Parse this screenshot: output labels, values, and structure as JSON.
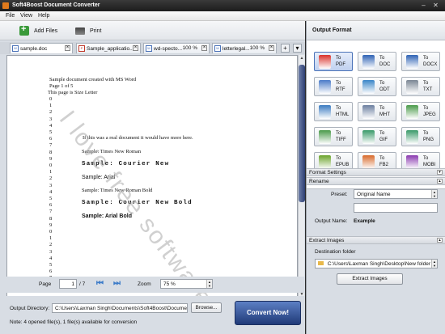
{
  "window": {
    "title": "Soft4Boost Document Converter"
  },
  "menu": [
    "File",
    "View",
    "Help"
  ],
  "toolbar": {
    "add_files": "Add Files",
    "print": "Print"
  },
  "tabs": [
    {
      "name": "sample.doc",
      "zoom": ""
    },
    {
      "name": "Sample_applicatio...",
      "zoom": ""
    },
    {
      "name": "wd-specto...",
      "zoom": "100 %"
    },
    {
      "name": "letterlegal...",
      "zoom": "100 %"
    }
  ],
  "document": {
    "header": [
      "Sample document created with MS Word",
      "Page 1 of 5",
      "This page is Size Letter"
    ],
    "numbers": [
      "0",
      "1",
      "2",
      "3",
      "4",
      "5",
      "6",
      "7",
      "8",
      "9",
      "0",
      "1",
      "2",
      "3",
      "4",
      "5",
      "6",
      "7",
      "8",
      "9",
      "0",
      "1",
      "2",
      "3",
      "4",
      "5",
      "6",
      "7"
    ],
    "samples": [
      "If this was a real document it would have more here.",
      "Sample:  Times New Roman",
      "Sample:  Courier New",
      "Sample:  Arial",
      "Sample:  Times New Roman Bold",
      "Sample:  Courier New Bold",
      "Sample:  Arial Bold"
    ],
    "watermark": "I love free software"
  },
  "pager": {
    "page_label": "Page",
    "page_value": "1",
    "page_total": "/ 7",
    "zoom_label": "Zoom",
    "zoom_value": "75 %"
  },
  "output": {
    "dir_label": "Output Directory:",
    "dir_value": "C:\\Users\\Laxman Singh\\Documents\\Soft4Boost\\Document",
    "browse": "Browse...",
    "note": "Note: 4 opened file(s), 1 file(s) available for conversion",
    "convert": "Convert Now!"
  },
  "right": {
    "header": "Output Format",
    "formats": [
      {
        "to": "To",
        "name": "PDF",
        "color": "#d9312b"
      },
      {
        "to": "To",
        "name": "DOC",
        "color": "#2f63b5"
      },
      {
        "to": "To",
        "name": "DOCX",
        "color": "#2f63b5"
      },
      {
        "to": "To",
        "name": "RTF",
        "color": "#4b7bc8"
      },
      {
        "to": "To",
        "name": "ODT",
        "color": "#3a86c8"
      },
      {
        "to": "To",
        "name": "TXT",
        "color": "#7a8694"
      },
      {
        "to": "To",
        "name": "HTML",
        "color": "#3a7ac0"
      },
      {
        "to": "To",
        "name": "MHT",
        "color": "#6b7fa0"
      },
      {
        "to": "To",
        "name": "JPEG",
        "color": "#4a9a4a"
      },
      {
        "to": "To",
        "name": "TIFF",
        "color": "#4a9a4a"
      },
      {
        "to": "To",
        "name": "GIF",
        "color": "#3a9a6a"
      },
      {
        "to": "To",
        "name": "PNG",
        "color": "#3a9a6a"
      },
      {
        "to": "To",
        "name": "EPUB",
        "color": "#6aa32b"
      },
      {
        "to": "To",
        "name": "FB2",
        "color": "#d86a2b"
      },
      {
        "to": "To",
        "name": "MOBI",
        "color": "#8a3ab0"
      }
    ],
    "format_settings": "Format Settings",
    "rename": "Rename",
    "preset_label": "Preset:",
    "preset_value": "Original Name",
    "output_name_label": "Output Name:",
    "output_name_value": "Example",
    "extract_images": "Extract Images",
    "dest_label": "Destination folder",
    "dest_value": "C:\\Users\\Laxman Singh\\Desktop\\New folder",
    "extract_button": "Extract Images"
  }
}
